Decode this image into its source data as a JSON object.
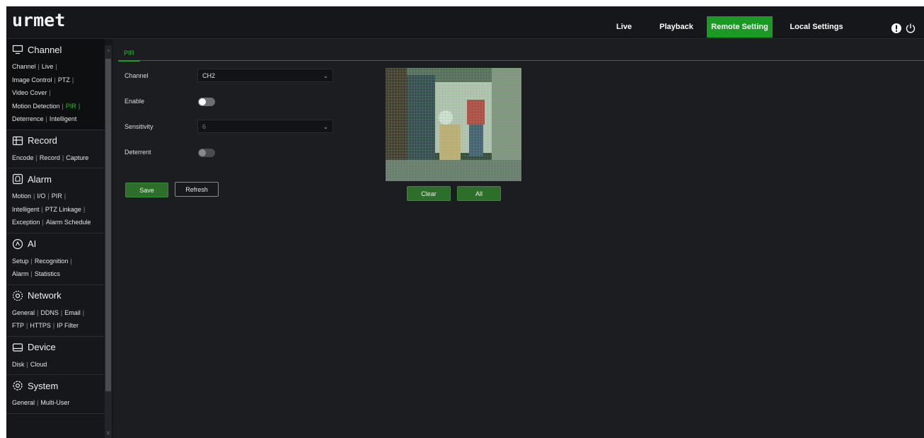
{
  "header": {
    "logo": "urmet",
    "nav": [
      {
        "label": "Live"
      },
      {
        "label": "Playback"
      },
      {
        "label": "Remote Setting"
      },
      {
        "label": "Local Settings"
      }
    ],
    "accent_color": "#1a9a23"
  },
  "sidebar": {
    "sections": [
      {
        "title": "Channel",
        "icon": "channel-icon",
        "rows": [
          [
            "Channel",
            "Live"
          ],
          [
            "Image Control",
            "PTZ"
          ],
          [
            "Video Cover"
          ],
          [
            "Motion Detection",
            "PIR"
          ],
          [
            "Deterrence",
            "Intelligent"
          ]
        ],
        "active": "PIR"
      },
      {
        "title": "Record",
        "icon": "record-icon",
        "rows": [
          [
            "Encode",
            "Record",
            "Capture"
          ]
        ]
      },
      {
        "title": "Alarm",
        "icon": "alarm-icon",
        "rows": [
          [
            "Motion",
            "I/O",
            "PIR"
          ],
          [
            "Intelligent",
            "PTZ Linkage"
          ],
          [
            "Exception",
            "Alarm Schedule"
          ]
        ]
      },
      {
        "title": "AI",
        "icon": "ai-icon",
        "rows": [
          [
            "Setup",
            "Recognition"
          ],
          [
            "Alarm",
            "Statistics"
          ]
        ]
      },
      {
        "title": "Network",
        "icon": "network-icon",
        "rows": [
          [
            "General",
            "DDNS",
            "Email"
          ],
          [
            "FTP",
            "HTTPS",
            "IP Filter"
          ]
        ]
      },
      {
        "title": "Device",
        "icon": "device-icon",
        "rows": [
          [
            "Disk",
            "Cloud"
          ]
        ]
      },
      {
        "title": "System",
        "icon": "system-icon",
        "rows": [
          [
            "General",
            "Multi-User"
          ]
        ]
      }
    ]
  },
  "main": {
    "tab": "PIR",
    "channel": {
      "label": "Channel",
      "value": "CH2"
    },
    "enable": {
      "label": "Enable",
      "on": false
    },
    "sensitivity": {
      "label": "Sensitivity",
      "value": "6"
    },
    "deterrent": {
      "label": "Deterrent",
      "on": false
    },
    "save_label": "Save",
    "refresh_label": "Refresh",
    "clear_label": "Clear",
    "all_label": "All"
  }
}
